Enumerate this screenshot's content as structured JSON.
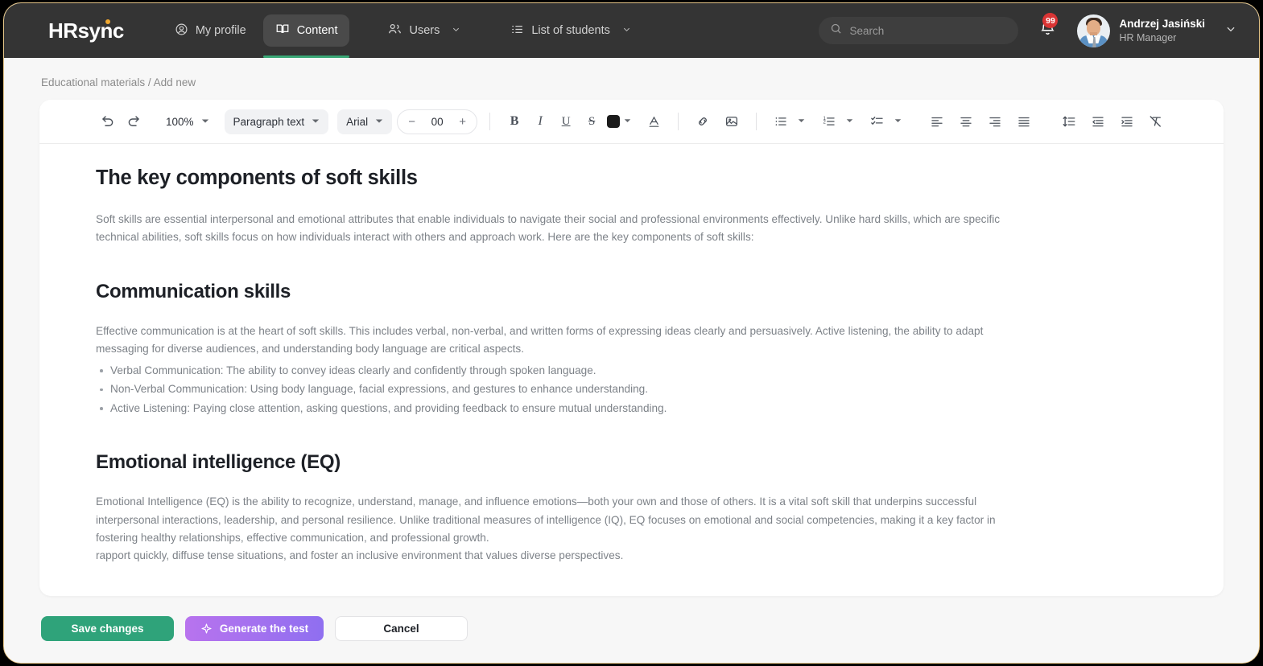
{
  "header": {
    "logo": "HRsync",
    "nav": [
      {
        "label": "My profile",
        "icon": "user-circle-icon",
        "active": false,
        "has_chevron": false
      },
      {
        "label": "Content",
        "icon": "book-icon",
        "active": true,
        "has_chevron": false
      },
      {
        "label": "Users",
        "icon": "users-icon",
        "active": false,
        "has_chevron": true
      },
      {
        "label": "List of students",
        "icon": "list-icon",
        "active": false,
        "has_chevron": true
      }
    ],
    "search": {
      "placeholder": "Search",
      "value": ""
    },
    "notifications": {
      "count": "99",
      "icon": "bell-icon"
    },
    "user": {
      "name": "Andrzej Jasiński",
      "role": "HR Manager",
      "chevron": "chevron-down-icon"
    }
  },
  "breadcrumb": "Educational materials / Add new",
  "toolbar": {
    "undo": "undo-icon",
    "redo": "redo-icon",
    "zoom": "100%",
    "paragraph_style": "Paragraph text",
    "font_family": "Arial",
    "font_size": "00",
    "minus": "−",
    "plus": "+",
    "bold": "B",
    "italic": "I",
    "underline": "U",
    "strikethrough": "S",
    "text_color_value": "#1b1b1b",
    "font_color": "A",
    "icons": [
      "link-icon",
      "image-icon",
      "bullet-list-icon",
      "numbered-list-icon",
      "checklist-icon",
      "align-left-icon",
      "align-center-icon",
      "align-right-icon",
      "align-justify-icon",
      "line-spacing-icon",
      "decrease-indent-icon",
      "increase-indent-icon",
      "clear-formatting-icon"
    ]
  },
  "document": {
    "title": "The key components of soft skills",
    "intro": "Soft skills are essential interpersonal and emotional attributes that enable individuals to navigate their social and professional environments effectively. Unlike hard skills, which are specific technical abilities, soft skills focus on how individuals interact with others and approach work. Here are the key components of soft skills:",
    "section1": {
      "heading": "Communication skills",
      "body": "Effective communication is at the heart of soft skills. This includes verbal, non-verbal, and written forms of expressing ideas clearly and persuasively. Active listening, the ability to adapt messaging for diverse audiences, and understanding body language are critical aspects.",
      "bullets": [
        "Verbal Communication: The ability to convey ideas clearly and confidently through spoken language.",
        "Non-Verbal Communication: Using body language, facial expressions, and gestures to enhance understanding.",
        "Active Listening: Paying close attention, asking questions, and providing feedback to ensure mutual understanding."
      ]
    },
    "section2": {
      "heading": "Emotional intelligence (EQ)",
      "body": "Emotional Intelligence (EQ) is the ability to recognize, understand, manage, and influence emotions—both your own and those of others. It is a vital soft skill that underpins successful interpersonal interactions, leadership, and personal resilience. Unlike traditional measures of intelligence (IQ), EQ focuses on emotional and social competencies, making it a key factor in fostering healthy relationships, effective communication, and professional growth.",
      "body2": "rapport quickly, diffuse tense situations, and foster an inclusive environment that values diverse perspectives."
    }
  },
  "footer": {
    "save_label": "Save changes",
    "generate_label": "Generate the test",
    "generate_icon": "sparkle-icon",
    "cancel_label": "Cancel"
  },
  "colors": {
    "header_bg": "#343434",
    "accent_green": "#2fa37a",
    "accent_purple": "#8f6ff0",
    "badge_red": "#d93434",
    "logo_dot": "#f0a830",
    "frame_border": "#e8c88a"
  }
}
